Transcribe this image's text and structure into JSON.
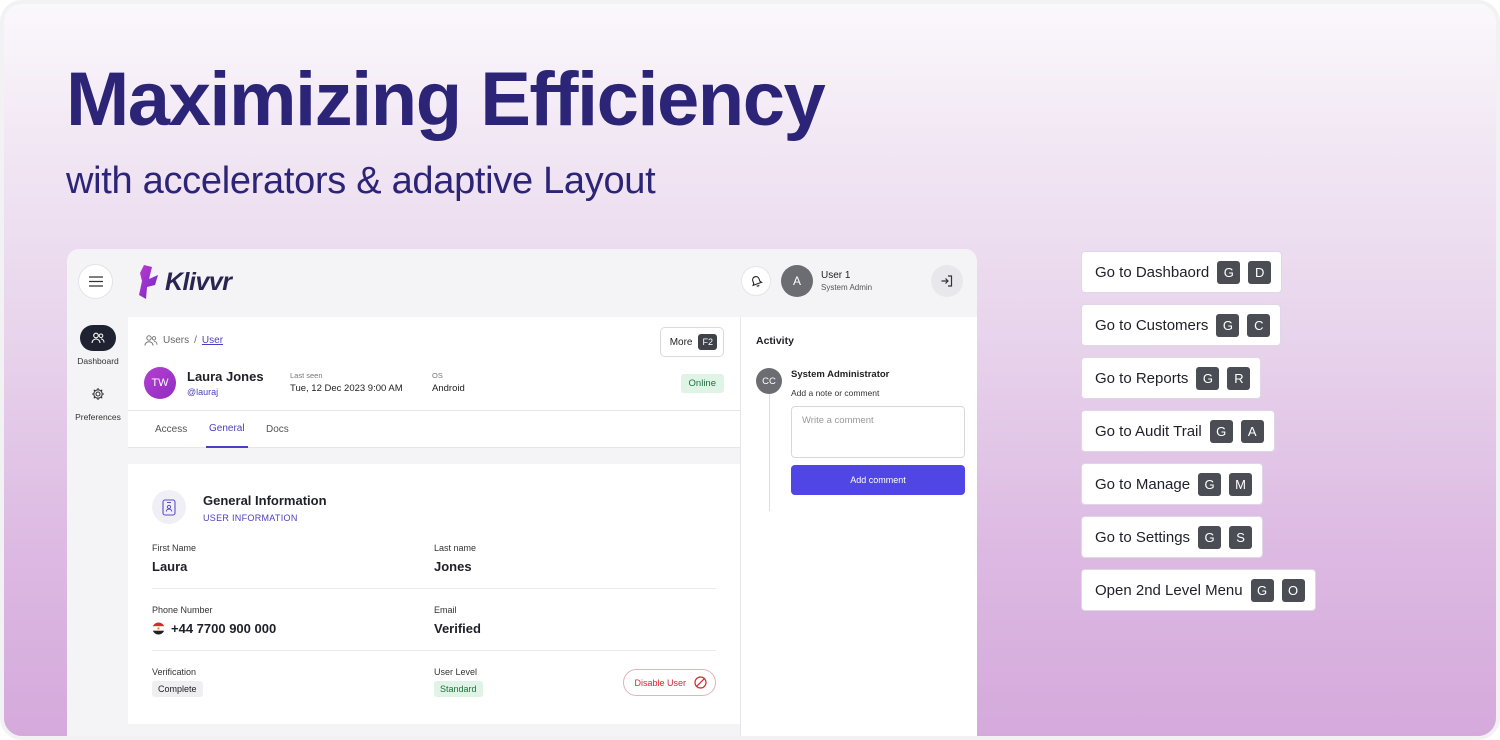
{
  "hero": {
    "title": "Maximizing Efficiency",
    "subtitle": "with accelerators & adaptive Layout"
  },
  "app": {
    "brand": "Klivvr",
    "user": {
      "initial": "A",
      "name": "User 1",
      "role": "System Admin"
    },
    "sidebar": [
      {
        "label": "Dashboard",
        "icon": "users-icon",
        "active": true
      },
      {
        "label": "Preferences",
        "icon": "gear-icon",
        "active": false
      }
    ],
    "breadcrumb": {
      "root": "Users",
      "separator": "/",
      "current": "User"
    },
    "more_button": {
      "label": "More",
      "shortcut": "F2"
    },
    "profile": {
      "initials": "TW",
      "name": "Laura Jones",
      "handle": "@lauraj",
      "last_seen_label": "Last seen",
      "last_seen_value": "Tue, 12 Dec 2023 9:00 AM",
      "os_label": "OS",
      "os_value": "Android",
      "status": "Online"
    },
    "tabs": [
      {
        "label": "Access",
        "active": false
      },
      {
        "label": "General",
        "active": true
      },
      {
        "label": "Docs",
        "active": false
      }
    ],
    "general": {
      "title": "General Information",
      "subtitle": "USER INFORMATION",
      "first_name_label": "First Name",
      "first_name": "Laura",
      "last_name_label": "Last name",
      "last_name": "Jones",
      "phone_label": "Phone Number",
      "phone": "+44 7700 900 000",
      "email_label": "Email",
      "email": "Verified",
      "verification_label": "Verification",
      "verification": "Complete",
      "user_level_label": "User Level",
      "user_level": "Standard",
      "disable_button": "Disable User"
    },
    "activity": {
      "title": "Activity",
      "avatar": "CC",
      "author": "System Administrator",
      "prompt": "Add a note or comment",
      "placeholder": "Write a comment",
      "button": "Add comment"
    }
  },
  "shortcuts": [
    {
      "label": "Go to Dashbaord",
      "keys": [
        "G",
        "D"
      ]
    },
    {
      "label": "Go to Customers",
      "keys": [
        "G",
        "C"
      ]
    },
    {
      "label": "Go to Reports",
      "keys": [
        "G",
        "R"
      ]
    },
    {
      "label": "Go to Audit Trail",
      "keys": [
        "G",
        "A"
      ]
    },
    {
      "label": "Go to Manage",
      "keys": [
        "G",
        "M"
      ]
    },
    {
      "label": "Go to Settings",
      "keys": [
        "G",
        "S"
      ]
    },
    {
      "label": "Open 2nd Level Menu",
      "keys": [
        "G",
        "O"
      ]
    }
  ],
  "colors": {
    "brand_text": "#2c2577",
    "accent": "#4f46e5",
    "online_bg": "#dff4e7",
    "danger": "#d6282f"
  }
}
